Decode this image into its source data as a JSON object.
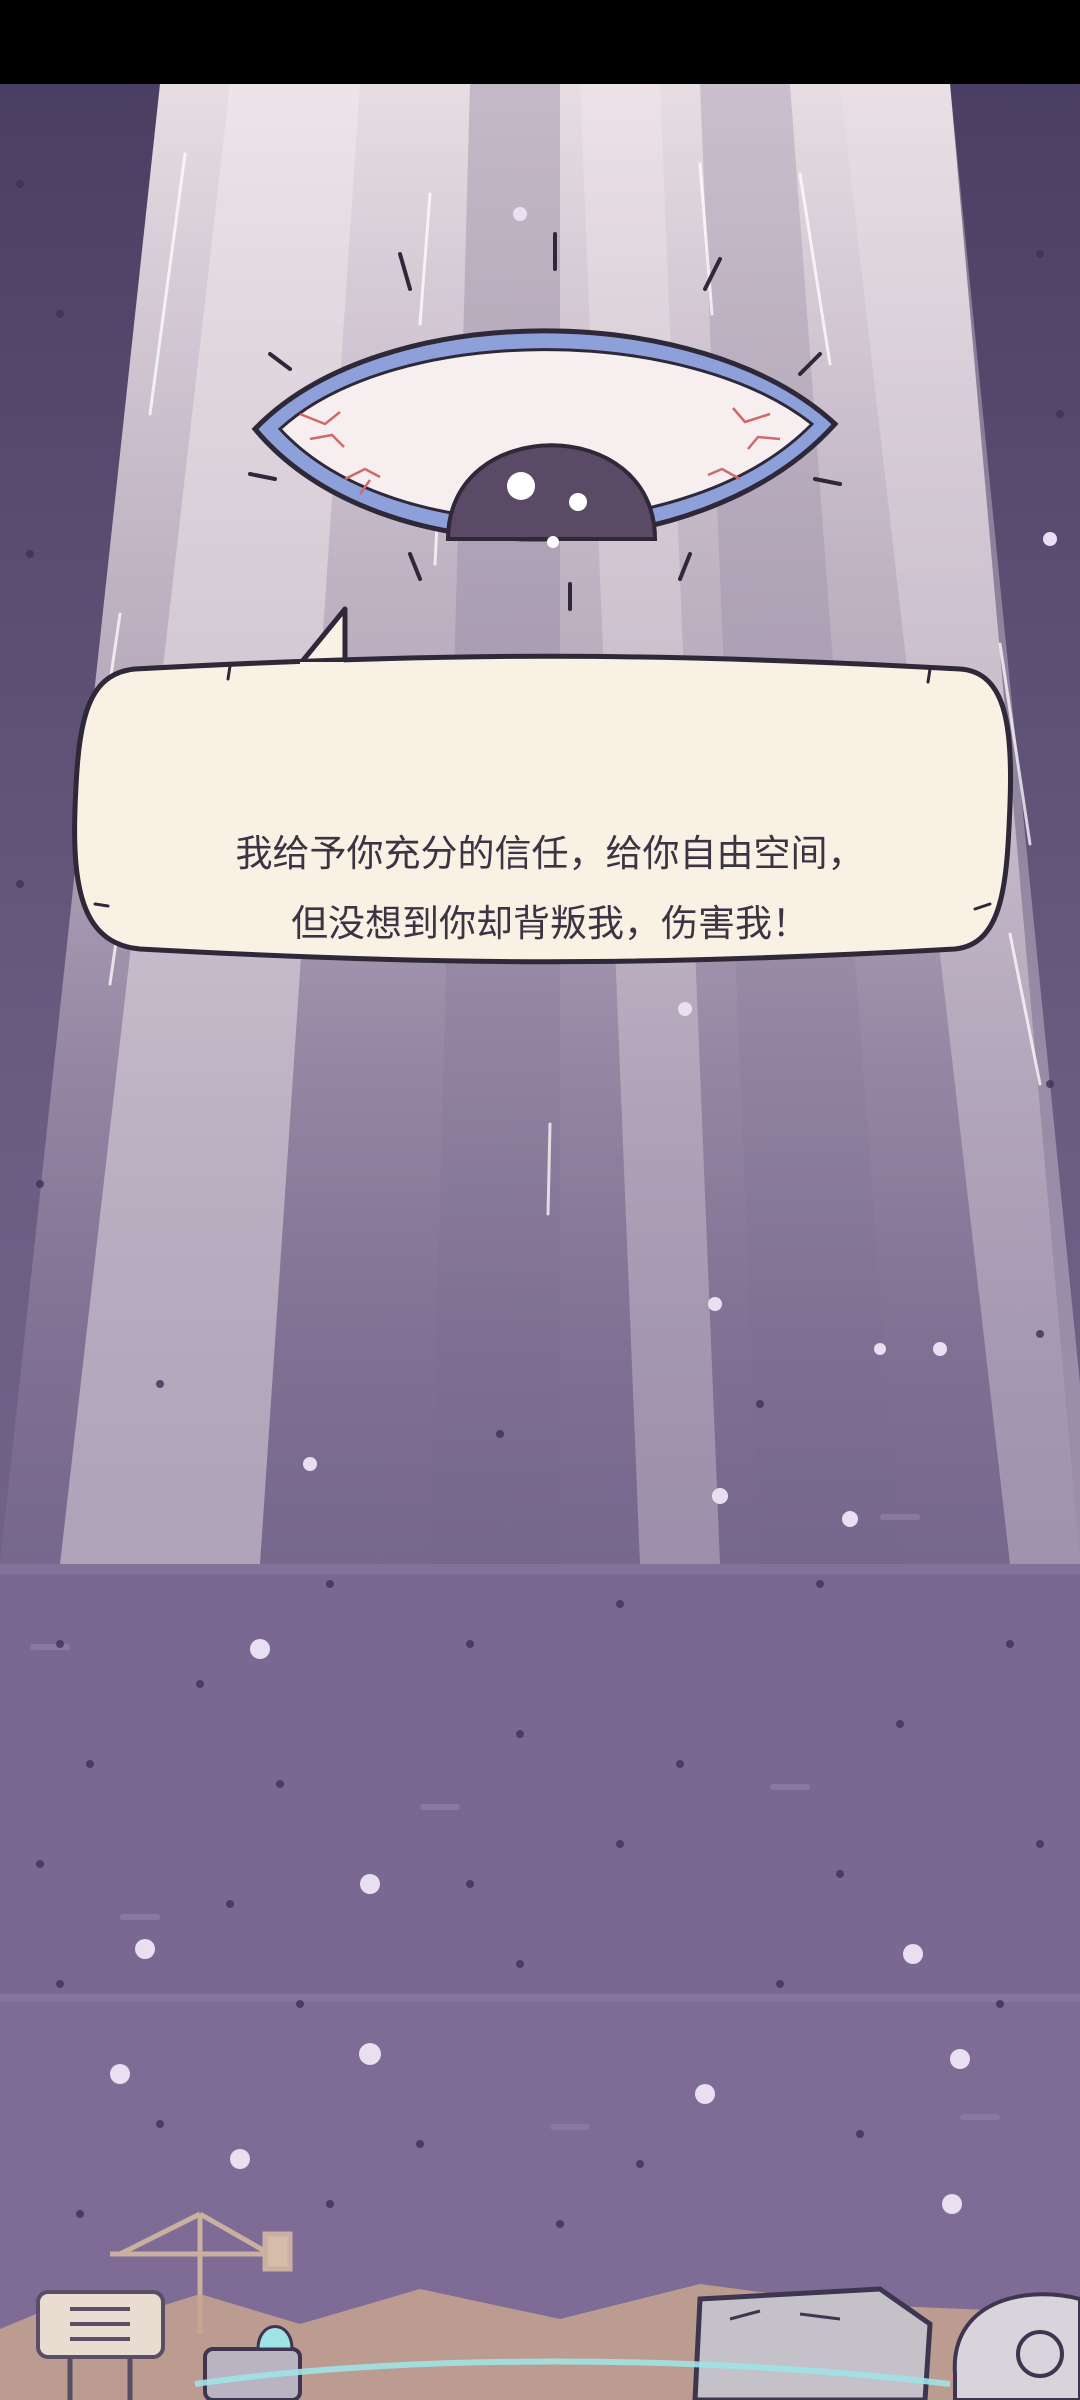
{
  "dialogue": {
    "line1": "我给予你充分的信任，给你自由空间，",
    "line2": "但没想到你却背叛我，伤害我！"
  },
  "colors": {
    "sky": "#4e4468",
    "light_beam": "#ebe1e6",
    "ground": "#7c6a93",
    "bubble_fill": "#f8f1e4",
    "eye_outline": "#6d7fc9",
    "pupil": "#5a4a66"
  },
  "icons": {
    "eye": "giant-eye-icon",
    "sign": "signboard-icon",
    "crane": "crane-icon",
    "rock": "rock-icon",
    "beacon": "beacon-icon"
  }
}
